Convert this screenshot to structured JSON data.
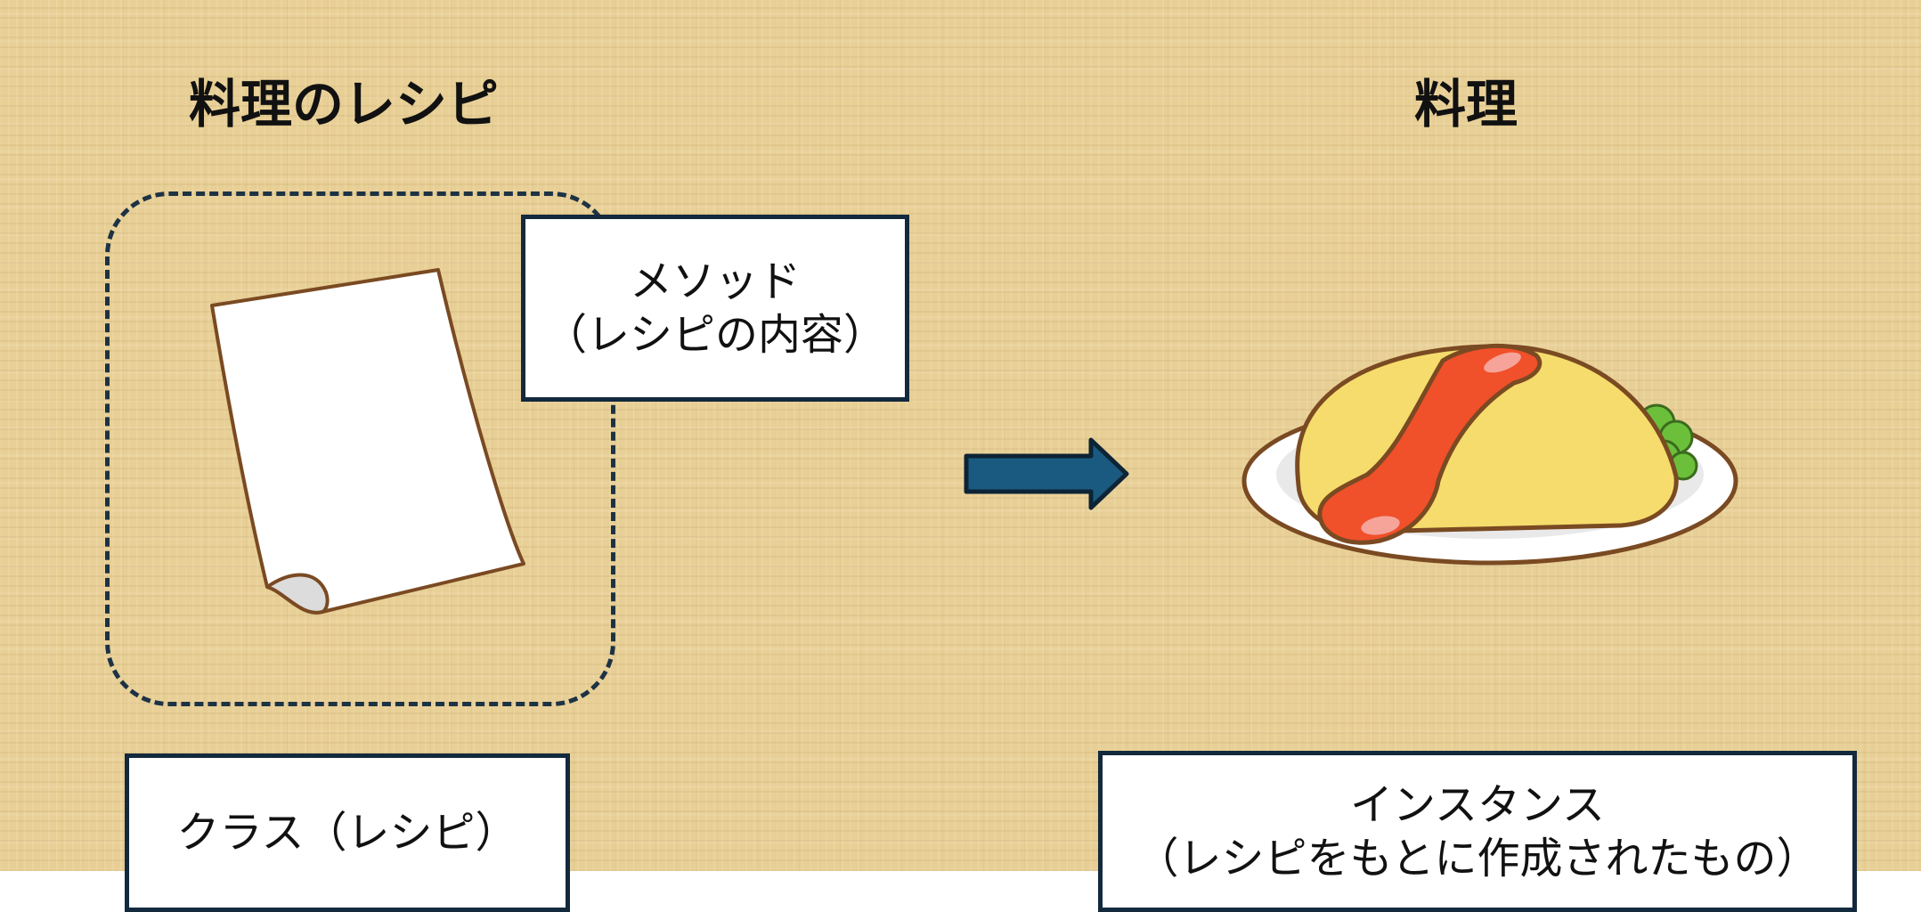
{
  "diagram": {
    "left_heading": "料理のレシピ",
    "right_heading": "料理",
    "method_box": {
      "line1": "メソッド",
      "line2": "（レシピの内容）"
    },
    "class_box": {
      "label": "クラス（レシピ）"
    },
    "instance_box": {
      "line1": "インスタンス",
      "line2": "（レシピをもとに作成されたもの）"
    }
  },
  "colors": {
    "background": "#e8cf95",
    "box_border": "#13293d",
    "arrow": "#1b5a80",
    "omelet": "#f5dc6c",
    "ketchup": "#f0502a",
    "parsley": "#6cbf3a"
  },
  "icons": {
    "paper": "blank-paper-icon",
    "arrow": "right-arrow-icon",
    "dish": "omurice-icon"
  }
}
